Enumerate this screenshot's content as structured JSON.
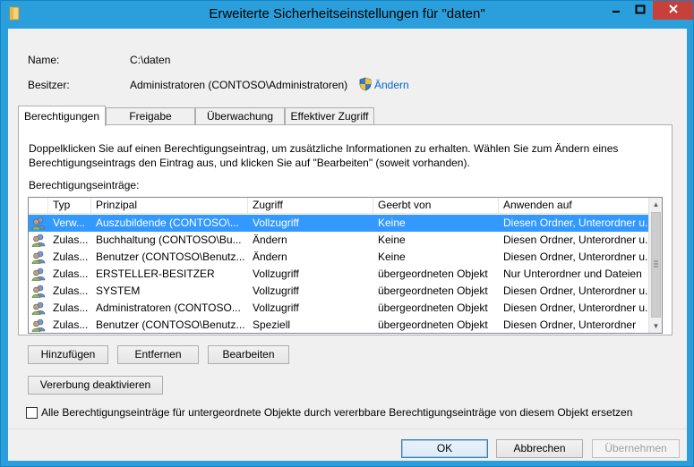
{
  "window": {
    "title": "Erweiterte Sicherheitseinstellungen für \"daten\"",
    "accent": "#2a9fdc",
    "close_color": "#c7413a"
  },
  "name_label": "Name:",
  "name_value": "C:\\daten",
  "owner_label": "Besitzer:",
  "owner_value": "Administratoren (CONTOSO\\Administratoren)",
  "owner_change_link": "Ändern",
  "tabs": [
    {
      "label": "Berechtigungen",
      "active": true
    },
    {
      "label": "Freigabe",
      "active": false
    },
    {
      "label": "Überwachung",
      "active": false
    },
    {
      "label": "Effektiver Zugriff",
      "active": false
    }
  ],
  "description_line1": "Doppelklicken Sie auf einen Berechtigungseintrag, um zusätzliche Informationen zu erhalten. Wählen Sie zum Ändern eines",
  "description_line2": "Berechtigungseintrags den Eintrag aus, und klicken Sie auf \"Bearbeiten\" (soweit vorhanden).",
  "entries_label": "Berechtigungseinträge:",
  "columns": [
    "Typ",
    "Prinzipal",
    "Zugriff",
    "Geerbt von",
    "Anwenden auf"
  ],
  "rows": [
    {
      "type": "Verw...",
      "principal": "Auszubildende (CONTOSO\\...",
      "access": "Vollzugriff",
      "inherited": "Keine",
      "applies": "Diesen Ordner, Unterordner u...",
      "selected": true
    },
    {
      "type": "Zulas...",
      "principal": "Buchhaltung (CONTOSO\\Bu...",
      "access": "Ändern",
      "inherited": "Keine",
      "applies": "Diesen Ordner, Unterordner u...",
      "selected": false
    },
    {
      "type": "Zulas...",
      "principal": "Benutzer (CONTOSO\\Benutz...",
      "access": "Ändern",
      "inherited": "Keine",
      "applies": "Diesen Ordner, Unterordner u...",
      "selected": false
    },
    {
      "type": "Zulas...",
      "principal": "ERSTELLER-BESITZER",
      "access": "Vollzugriff",
      "inherited": "übergeordneten Objekt",
      "applies": "Nur Unterordner und Dateien",
      "selected": false
    },
    {
      "type": "Zulas...",
      "principal": "SYSTEM",
      "access": "Vollzugriff",
      "inherited": "übergeordneten Objekt",
      "applies": "Diesen Ordner, Unterordner u...",
      "selected": false
    },
    {
      "type": "Zulas...",
      "principal": "Administratoren (CONTOSO...",
      "access": "Vollzugriff",
      "inherited": "übergeordneten Objekt",
      "applies": "Diesen Ordner, Unterordner u...",
      "selected": false
    },
    {
      "type": "Zulas...",
      "principal": "Benutzer (CONTOSO\\Benutz...",
      "access": "Speziell",
      "inherited": "übergeordneten Objekt",
      "applies": "Diesen Ordner, Unterordner",
      "selected": false
    }
  ],
  "buttons": {
    "add": "Hinzufügen",
    "remove": "Entfernen",
    "edit": "Bearbeiten",
    "disable_inheritance": "Vererbung deaktivieren",
    "ok": "OK",
    "cancel": "Abbrechen",
    "apply": "Übernehmen"
  },
  "replace_checkbox": {
    "label": "Alle Berechtigungseinträge für untergeordnete Objekte durch vererbbare Berechtigungseinträge von diesem Objekt ersetzen",
    "checked": false
  }
}
